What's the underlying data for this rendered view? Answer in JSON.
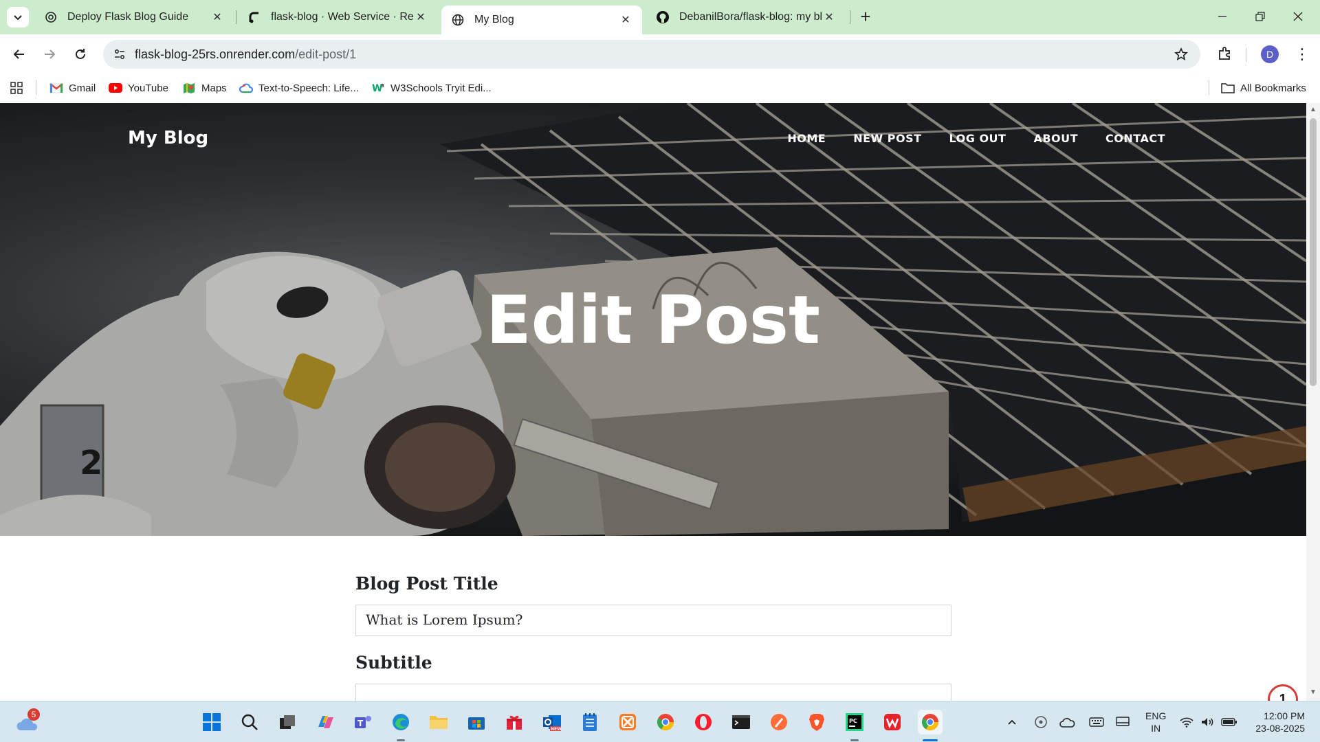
{
  "browser": {
    "tabs": [
      {
        "title": "Deploy Flask Blog Guide",
        "icon": "openai-icon",
        "active": false
      },
      {
        "title": "flask-blog · Web Service · Render",
        "icon": "render-icon",
        "active": false
      },
      {
        "title": "My Blog",
        "icon": "globe-icon",
        "active": true
      },
      {
        "title": "DebanilBora/flask-blog: my blog",
        "icon": "github-icon",
        "active": false
      }
    ],
    "close_glyph": "✕",
    "new_tab_glyph": "+",
    "address": {
      "domain": "flask-blog-25rs.onrender.com",
      "path": "/edit-post/1"
    },
    "profile_initial": "D",
    "bookmarks": [
      {
        "label": "Gmail",
        "icon": "gmail-icon"
      },
      {
        "label": "YouTube",
        "icon": "youtube-icon"
      },
      {
        "label": "Maps",
        "icon": "maps-icon"
      },
      {
        "label": "Text-to-Speech: Life...",
        "icon": "google-cloud-icon"
      },
      {
        "label": "W3Schools Tryit Edi...",
        "icon": "w3schools-icon"
      }
    ],
    "all_bookmarks_label": "All Bookmarks"
  },
  "page": {
    "brand": "My Blog",
    "nav": [
      "HOME",
      "NEW POST",
      "LOG OUT",
      "ABOUT",
      "CONTACT"
    ],
    "hero_title": "Edit Post",
    "form": {
      "title_label": "Blog Post Title",
      "title_value": "What is Lorem Ipsum?",
      "subtitle_label": "Subtitle"
    },
    "notification_count": "1"
  },
  "taskbar": {
    "weather_badge": "5",
    "apps": [
      "start-icon",
      "search-icon",
      "task-view-icon",
      "copilot-icon",
      "teams-icon",
      "edge-icon",
      "file-explorer-icon",
      "microsoft-store-icon",
      "gift-icon",
      "outlook-icon",
      "notepad-icon",
      "xampp-icon",
      "chrome-icon",
      "opera-icon",
      "terminal-icon",
      "postman-icon",
      "brave-icon",
      "pycharm-icon",
      "wps-icon",
      "chrome-active-icon"
    ],
    "language": {
      "line1": "ENG",
      "line2": "IN"
    },
    "clock": {
      "time": "12:00 PM",
      "date": "23-08-2025"
    }
  },
  "colors": {
    "tabstrip": "#cdeccd",
    "accent_red": "#d63b3b",
    "taskbar": "#d6e7ef"
  }
}
